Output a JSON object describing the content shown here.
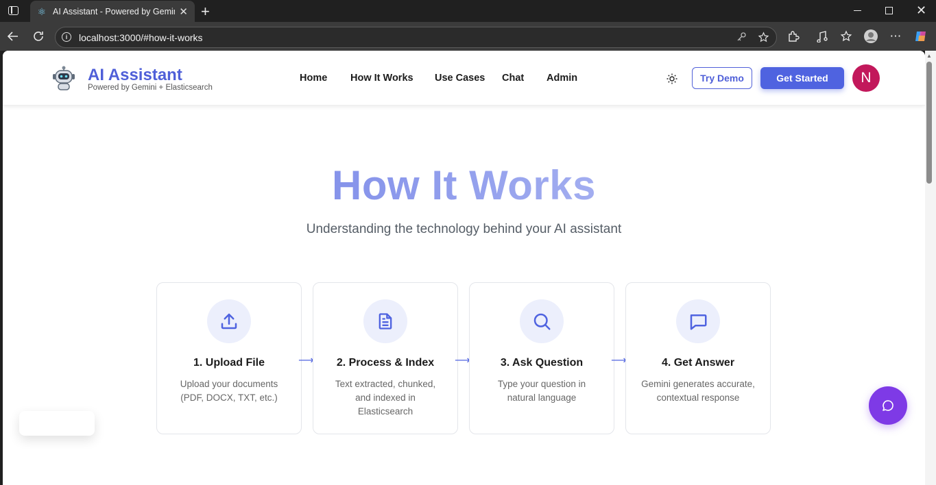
{
  "browser": {
    "tab_title": "AI Assistant - Powered by Gemini + Elasticsearch",
    "url": "localhost:3000/#how-it-works"
  },
  "header": {
    "brand_title": "AI Assistant",
    "brand_subtitle": "Powered by Gemini + Elasticsearch",
    "nav": [
      "Home",
      "How It Works",
      "Use Cases",
      "Chat",
      "Admin"
    ],
    "try_demo_label": "Try Demo",
    "get_started_label": "Get Started",
    "avatar_initial": "N"
  },
  "hero": {
    "title": "How It Works",
    "subtitle": "Understanding the technology behind your AI assistant"
  },
  "steps": [
    {
      "title": "1. Upload File",
      "description": "Upload your documents (PDF, DOCX, TXT, etc.)",
      "icon": "upload-icon"
    },
    {
      "title": "2. Process & Index",
      "description": "Text extracted, chunked, and indexed in Elasticsearch",
      "icon": "document-icon"
    },
    {
      "title": "3. Ask Question",
      "description": "Type your question in natural language",
      "icon": "search-icon"
    },
    {
      "title": "4. Get Answer",
      "description": "Gemini generates accurate, contextual response",
      "icon": "message-icon"
    }
  ],
  "colors": {
    "accent": "#4f63e0",
    "fab": "#7e3ae6",
    "avatar": "#c2185b"
  }
}
